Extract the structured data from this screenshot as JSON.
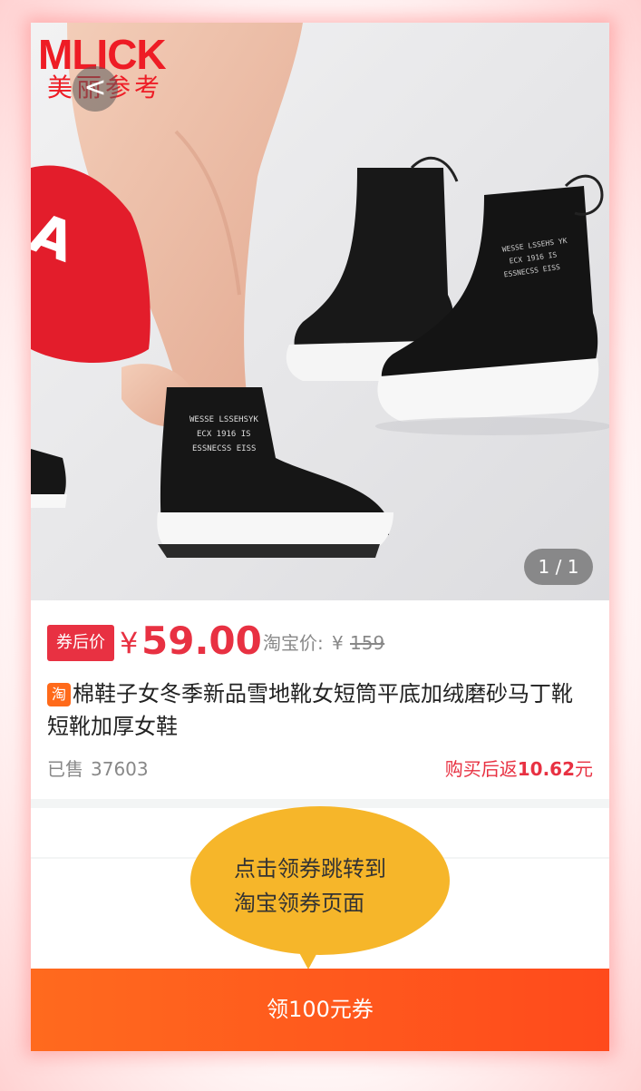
{
  "hero": {
    "logo_en": "MLICK",
    "logo_cn": "美丽参考",
    "back_glyph": "<",
    "image_counter": "1 / 1",
    "shoe_print_lines": [
      "WESSE LSSEHSYK",
      "ECX 1916 IS",
      "ESSNECSS EISS"
    ]
  },
  "price": {
    "badge": "券后价",
    "currency": "¥",
    "amount": "59.00",
    "taobao_label": "淘宝价:",
    "taobao_currency": "¥",
    "taobao_price": "159"
  },
  "product": {
    "platform_icon": "淘",
    "title": "棉鞋子女冬季新品雪地靴女短筒平底加绒磨砂马丁靴短靴加厚女鞋",
    "sold_label": "已售",
    "sold_count": "37603",
    "rebate_prefix": "购买后返",
    "rebate_amount": "10.62",
    "rebate_unit": "元"
  },
  "tooltip": {
    "line1": "点击领券跳转到",
    "line2": "淘宝领券页面"
  },
  "coupon_button": {
    "label": "领100元券"
  },
  "colors": {
    "accent_red": "#e83142",
    "button_orange": "#ff5a1e",
    "bubble_yellow": "#f6b62a"
  }
}
